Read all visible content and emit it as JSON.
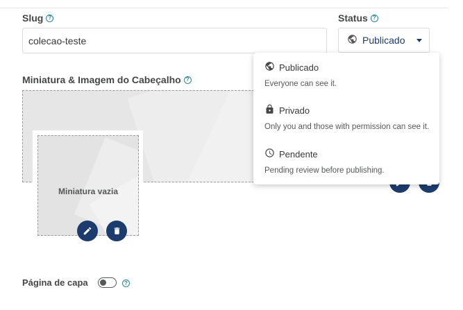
{
  "slug": {
    "label": "Slug",
    "value": "colecao-teste"
  },
  "status": {
    "label": "Status",
    "selected": "Publicado",
    "options": [
      {
        "title": "Publicado",
        "description": "Everyone can see it.",
        "icon": "globe-icon"
      },
      {
        "title": "Privado",
        "description": "Only you and those with permission can see it.",
        "icon": "lock-icon"
      },
      {
        "title": "Pendente",
        "description": "Pending review before publishing.",
        "icon": "clock-icon"
      }
    ]
  },
  "media": {
    "label": "Miniatura & Imagem do Cabeçalho",
    "thumbnail_empty": "Miniatura vazia"
  },
  "cover": {
    "label": "Página de capa",
    "enabled": false
  },
  "help_glyph": "?",
  "colors": {
    "primary": "#1d3c6e",
    "help": "#298596",
    "placeholder_bg": "#e6e6e6"
  }
}
